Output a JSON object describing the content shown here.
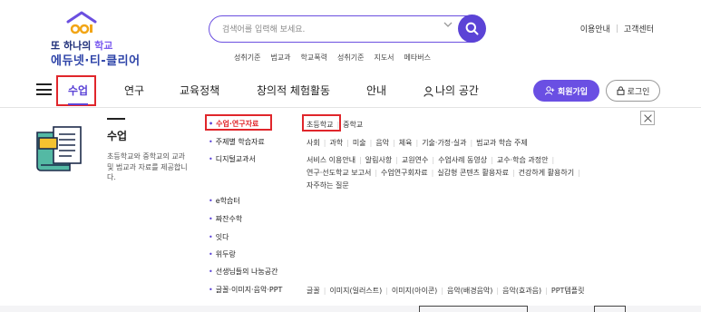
{
  "logo": {
    "line1_a": "또 하나의",
    "line1_b": " 학교",
    "line2": "에듀넷·티-클리어"
  },
  "search": {
    "placeholder": "검색어를 입력해 보세요.",
    "accent": "#5b43d6"
  },
  "keywords": [
    "성취기준",
    "범교과",
    "학교폭력",
    "성취기준",
    "지도서",
    "메타버스"
  ],
  "util": {
    "guide": "이용안내",
    "support": "고객센터"
  },
  "nav": {
    "items": [
      "수업",
      "연구",
      "교육정책",
      "창의적 체험활동",
      "안내",
      "나의 공간"
    ],
    "join": "회원가입",
    "login": "로그인"
  },
  "panel": {
    "title": "수업",
    "description": "초등학교와 중학교의 교과 및 범교과 자료를 제공합니다.",
    "categories": [
      "수업·연구자료",
      "주제별 학습자료",
      "디지털교과서",
      "e학습터",
      "짜잔수학",
      "잇다",
      "위두랑",
      "선생님들의 나눔공간",
      "글꼴·이미지·음악·PPT"
    ],
    "sub_school": [
      "초등학교",
      "중학교"
    ],
    "sub_topic": [
      "사회",
      "과학",
      "미술",
      "음악",
      "체육",
      "기술·가정·실과",
      "범교과 학습 주제"
    ],
    "sub_digital_1": [
      "서비스 이용안내",
      "알림사항",
      "교원연수",
      "수업사례 동영상",
      "교수·학습 과정안"
    ],
    "sub_digital_2": [
      "연구·선도학교 보고서",
      "수업연구회자료",
      "실감형 콘텐츠 활용자료",
      "건강하게 활용하기"
    ],
    "sub_digital_3": [
      "자주하는 질문"
    ],
    "sub_font": [
      "글꼴",
      "이미지(일러스트)",
      "이미지(아이콘)",
      "음악(배경음악)",
      "음악(효과음)",
      "PPT템플릿"
    ]
  }
}
